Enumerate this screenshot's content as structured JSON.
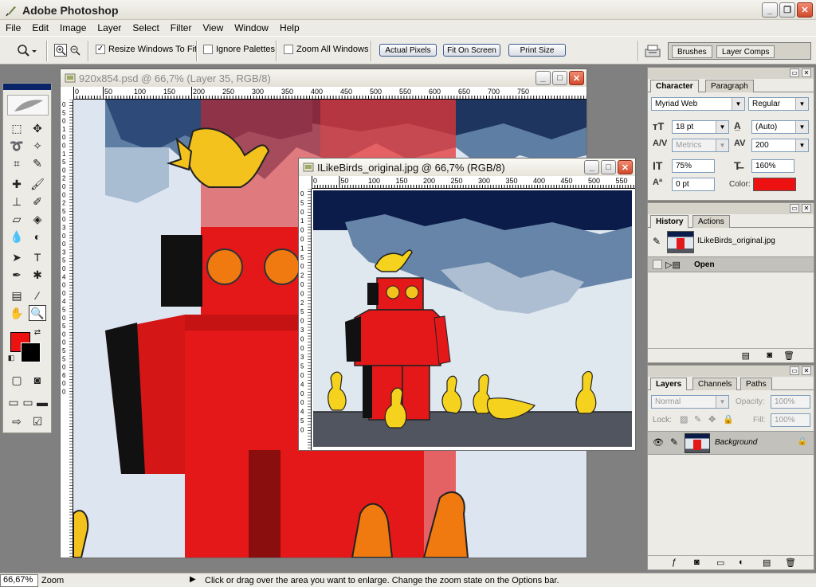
{
  "app": {
    "title": "Adobe Photoshop"
  },
  "menu": [
    "File",
    "Edit",
    "Image",
    "Layer",
    "Select",
    "Filter",
    "View",
    "Window",
    "Help"
  ],
  "options": {
    "resize_windows_label": "Resize Windows To Fit",
    "ignore_palettes_label": "Ignore Palettes",
    "zoom_all_label": "Zoom All Windows",
    "actual_pixels": "Actual Pixels",
    "fit_on_screen": "Fit On Screen",
    "print_size": "Print Size",
    "well_tabs": [
      "Brushes",
      "Layer Comps"
    ]
  },
  "doc1": {
    "title": "920x854.psd @ 66,7% (Layer 35, RGB/8)",
    "ruler_top": [
      "0",
      "50",
      "100",
      "150",
      "200",
      "250",
      "300",
      "350",
      "400",
      "450",
      "500",
      "550",
      "600",
      "650",
      "700",
      "750"
    ],
    "ruler_left": [
      "0",
      "5",
      "0",
      "1",
      "0",
      "0",
      "1",
      "5",
      "0",
      "2",
      "0",
      "0",
      "2",
      "5",
      "0",
      "3",
      "0",
      "0",
      "3",
      "5",
      "0",
      "4",
      "0",
      "0",
      "4",
      "5",
      "0",
      "5",
      "0",
      "0",
      "5",
      "5",
      "0",
      "6",
      "0",
      "0"
    ]
  },
  "doc2": {
    "title": "ILikeBirds_original.jpg @ 66,7% (RGB/8)",
    "ruler_top": [
      "0",
      "50",
      "100",
      "150",
      "200",
      "250",
      "300",
      "350",
      "400",
      "450",
      "500",
      "550"
    ],
    "ruler_left": [
      "0",
      "5",
      "0",
      "1",
      "0",
      "0",
      "1",
      "5",
      "0",
      "2",
      "0",
      "0",
      "2",
      "5",
      "0",
      "3",
      "0",
      "0",
      "3",
      "5",
      "0",
      "4",
      "0",
      "0",
      "4",
      "5",
      "0"
    ]
  },
  "character": {
    "tabs": [
      "Character",
      "Paragraph"
    ],
    "font_family": "Myriad Web",
    "font_style": "Regular",
    "size": "18 pt",
    "leading": "(Auto)",
    "kerning": "Metrics",
    "tracking": "200",
    "vscale": "75%",
    "hscale": "160%",
    "baseline": "0 pt",
    "color_label": "Color:",
    "color": "#ee1111"
  },
  "history": {
    "tabs": [
      "History",
      "Actions"
    ],
    "snapshot": "ILikeBirds_original.jpg",
    "state": "Open"
  },
  "layers": {
    "tabs": [
      "Layers",
      "Channels",
      "Paths"
    ],
    "blend": "Normal",
    "opacity_label": "Opacity:",
    "opacity": "100%",
    "lock_label": "Lock:",
    "fill_label": "Fill:",
    "fill": "100%",
    "layer_name": "Background"
  },
  "status": {
    "zoom": "66,67%",
    "tool": "Zoom",
    "hint": "Click or drag over the area you want to enlarge. Change the zoom state on the Options bar."
  }
}
